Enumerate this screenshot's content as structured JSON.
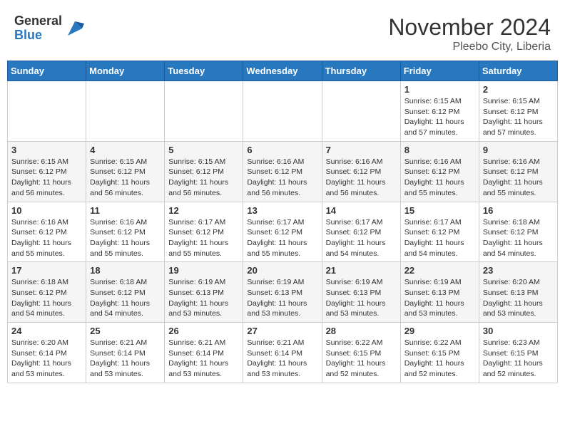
{
  "header": {
    "logo_line1": "General",
    "logo_line2": "Blue",
    "month_year": "November 2024",
    "location": "Pleebo City, Liberia"
  },
  "weekdays": [
    "Sunday",
    "Monday",
    "Tuesday",
    "Wednesday",
    "Thursday",
    "Friday",
    "Saturday"
  ],
  "weeks": [
    [
      {
        "day": "",
        "info": ""
      },
      {
        "day": "",
        "info": ""
      },
      {
        "day": "",
        "info": ""
      },
      {
        "day": "",
        "info": ""
      },
      {
        "day": "",
        "info": ""
      },
      {
        "day": "1",
        "info": "Sunrise: 6:15 AM\nSunset: 6:12 PM\nDaylight: 11 hours\nand 57 minutes."
      },
      {
        "day": "2",
        "info": "Sunrise: 6:15 AM\nSunset: 6:12 PM\nDaylight: 11 hours\nand 57 minutes."
      }
    ],
    [
      {
        "day": "3",
        "info": "Sunrise: 6:15 AM\nSunset: 6:12 PM\nDaylight: 11 hours\nand 56 minutes."
      },
      {
        "day": "4",
        "info": "Sunrise: 6:15 AM\nSunset: 6:12 PM\nDaylight: 11 hours\nand 56 minutes."
      },
      {
        "day": "5",
        "info": "Sunrise: 6:15 AM\nSunset: 6:12 PM\nDaylight: 11 hours\nand 56 minutes."
      },
      {
        "day": "6",
        "info": "Sunrise: 6:16 AM\nSunset: 6:12 PM\nDaylight: 11 hours\nand 56 minutes."
      },
      {
        "day": "7",
        "info": "Sunrise: 6:16 AM\nSunset: 6:12 PM\nDaylight: 11 hours\nand 56 minutes."
      },
      {
        "day": "8",
        "info": "Sunrise: 6:16 AM\nSunset: 6:12 PM\nDaylight: 11 hours\nand 55 minutes."
      },
      {
        "day": "9",
        "info": "Sunrise: 6:16 AM\nSunset: 6:12 PM\nDaylight: 11 hours\nand 55 minutes."
      }
    ],
    [
      {
        "day": "10",
        "info": "Sunrise: 6:16 AM\nSunset: 6:12 PM\nDaylight: 11 hours\nand 55 minutes."
      },
      {
        "day": "11",
        "info": "Sunrise: 6:16 AM\nSunset: 6:12 PM\nDaylight: 11 hours\nand 55 minutes."
      },
      {
        "day": "12",
        "info": "Sunrise: 6:17 AM\nSunset: 6:12 PM\nDaylight: 11 hours\nand 55 minutes."
      },
      {
        "day": "13",
        "info": "Sunrise: 6:17 AM\nSunset: 6:12 PM\nDaylight: 11 hours\nand 55 minutes."
      },
      {
        "day": "14",
        "info": "Sunrise: 6:17 AM\nSunset: 6:12 PM\nDaylight: 11 hours\nand 54 minutes."
      },
      {
        "day": "15",
        "info": "Sunrise: 6:17 AM\nSunset: 6:12 PM\nDaylight: 11 hours\nand 54 minutes."
      },
      {
        "day": "16",
        "info": "Sunrise: 6:18 AM\nSunset: 6:12 PM\nDaylight: 11 hours\nand 54 minutes."
      }
    ],
    [
      {
        "day": "17",
        "info": "Sunrise: 6:18 AM\nSunset: 6:12 PM\nDaylight: 11 hours\nand 54 minutes."
      },
      {
        "day": "18",
        "info": "Sunrise: 6:18 AM\nSunset: 6:12 PM\nDaylight: 11 hours\nand 54 minutes."
      },
      {
        "day": "19",
        "info": "Sunrise: 6:19 AM\nSunset: 6:13 PM\nDaylight: 11 hours\nand 53 minutes."
      },
      {
        "day": "20",
        "info": "Sunrise: 6:19 AM\nSunset: 6:13 PM\nDaylight: 11 hours\nand 53 minutes."
      },
      {
        "day": "21",
        "info": "Sunrise: 6:19 AM\nSunset: 6:13 PM\nDaylight: 11 hours\nand 53 minutes."
      },
      {
        "day": "22",
        "info": "Sunrise: 6:19 AM\nSunset: 6:13 PM\nDaylight: 11 hours\nand 53 minutes."
      },
      {
        "day": "23",
        "info": "Sunrise: 6:20 AM\nSunset: 6:13 PM\nDaylight: 11 hours\nand 53 minutes."
      }
    ],
    [
      {
        "day": "24",
        "info": "Sunrise: 6:20 AM\nSunset: 6:14 PM\nDaylight: 11 hours\nand 53 minutes."
      },
      {
        "day": "25",
        "info": "Sunrise: 6:21 AM\nSunset: 6:14 PM\nDaylight: 11 hours\nand 53 minutes."
      },
      {
        "day": "26",
        "info": "Sunrise: 6:21 AM\nSunset: 6:14 PM\nDaylight: 11 hours\nand 53 minutes."
      },
      {
        "day": "27",
        "info": "Sunrise: 6:21 AM\nSunset: 6:14 PM\nDaylight: 11 hours\nand 53 minutes."
      },
      {
        "day": "28",
        "info": "Sunrise: 6:22 AM\nSunset: 6:15 PM\nDaylight: 11 hours\nand 52 minutes."
      },
      {
        "day": "29",
        "info": "Sunrise: 6:22 AM\nSunset: 6:15 PM\nDaylight: 11 hours\nand 52 minutes."
      },
      {
        "day": "30",
        "info": "Sunrise: 6:23 AM\nSunset: 6:15 PM\nDaylight: 11 hours\nand 52 minutes."
      }
    ]
  ]
}
